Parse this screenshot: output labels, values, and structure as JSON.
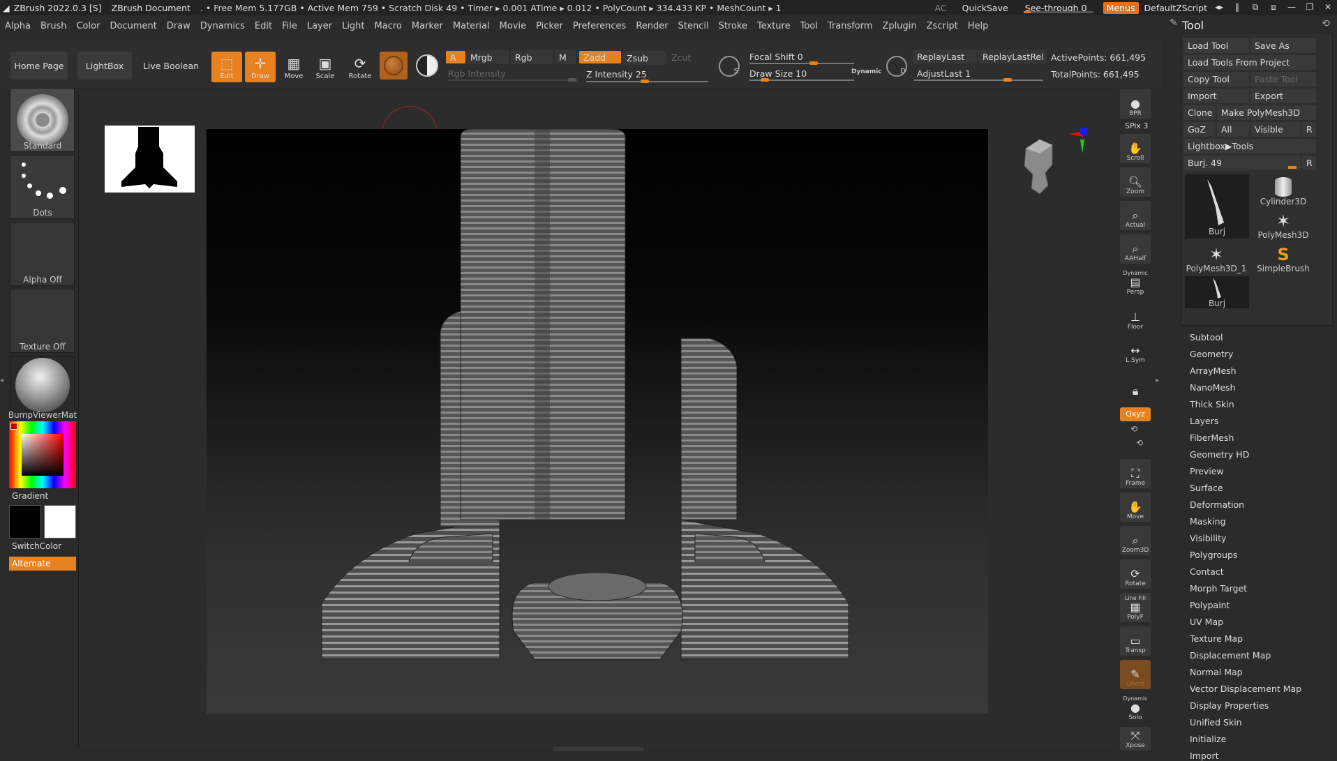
{
  "titlebar": {
    "app": "ZBrush 2022.0.3 [S]",
    "document": "ZBrush Document",
    "stats": ". • Free Mem 5.177GB • Active Mem 759 • Scratch Disk 49 •  Timer ▸ 0.001 ATime ▸ 0.012 • PolyCount ▸ 334.433 KP  • MeshCount ▸ 1",
    "ac": "AC",
    "quicksave": "QuickSave",
    "see_through_label": "See-through  0",
    "menus": "Menus",
    "default_zscript": "DefaultZScript"
  },
  "menubar": [
    "Alpha",
    "Brush",
    "Color",
    "Document",
    "Draw",
    "Dynamics",
    "Edit",
    "File",
    "Layer",
    "Light",
    "Macro",
    "Marker",
    "Material",
    "Movie",
    "Picker",
    "Preferences",
    "Render",
    "Stencil",
    "Stroke",
    "Texture",
    "Tool",
    "Transform",
    "Zplugin",
    "Zscript",
    "Help"
  ],
  "controls": {
    "home_page": "Home Page",
    "lightbox": "LightBox",
    "live_boolean": "Live Boolean",
    "edit": "Edit",
    "draw": "Draw",
    "move": "Move",
    "scale": "Scale",
    "rotate": "Rotate",
    "a": "A",
    "mrgb": "Mrgb",
    "rgb": "Rgb",
    "m": "M",
    "zadd": "Zadd",
    "zsub": "Zsub",
    "zcut": "Zcut",
    "rgb_intensity": "Rgb Intensity",
    "z_intensity": "Z Intensity 25",
    "focal_shift": "Focal Shift 0",
    "draw_size": "Draw Size 10",
    "dynamic": "Dynamic",
    "replay_last": "ReplayLast",
    "replay_last_rel": "ReplayLastRel",
    "adjust_last": "AdjustLast 1",
    "active_points": "ActivePoints: 661,495",
    "total_points": "TotalPoints: 661,495",
    "s_label": "S",
    "d_label": "D"
  },
  "left": {
    "brush": "Standard",
    "stroke": "Dots",
    "alpha": "Alpha Off",
    "texture": "Texture Off",
    "material": "BumpViewerMat",
    "gradient": "Gradient",
    "switch_color": "SwitchColor",
    "alternate": "Alternate"
  },
  "rightbar": {
    "bpr": "BPR",
    "spix": "SPix 3",
    "scroll": "Scroll",
    "zoom": "Zoom",
    "actual": "Actual",
    "aahalf": "AAHalf",
    "dynamic": "Dynamic",
    "persp": "Persp",
    "floor": "Floor",
    "lsym": "L.Sym",
    "xyz": "Qxyz",
    "frame": "Frame",
    "move": "Move",
    "zoom3d": "Zoom3D",
    "rotate": "Rotate",
    "line_fill": "Line Fill",
    "polyf": "PolyF",
    "transp": "Transp",
    "ghost": "Ghost",
    "dynamic2": "Dynamic",
    "solo": "Solo",
    "xpose": "Xpose"
  },
  "tool": {
    "title": "Tool",
    "load_tool": "Load Tool",
    "save_as": "Save As",
    "load_from_project": "Load Tools From Project",
    "copy_tool": "Copy Tool",
    "paste_tool": "Paste Tool",
    "import": "Import",
    "export": "Export",
    "clone": "Clone",
    "make_polymesh": "Make PolyMesh3D",
    "goz": "GoZ",
    "all": "All",
    "visible": "Visible",
    "r": "R",
    "lightbox_tools": "Lightbox▶Tools",
    "burj_slider": "Burj. 49",
    "thumbs": [
      "Burj",
      "Cylinder3D",
      "PolyMesh3D",
      "PolyMesh3D_1",
      "SimpleBrush",
      "Burj"
    ],
    "sections": [
      "Subtool",
      "Geometry",
      "ArrayMesh",
      "NanoMesh",
      "Thick Skin",
      "Layers",
      "FiberMesh",
      "Geometry HD",
      "Preview",
      "Surface",
      "Deformation",
      "Masking",
      "Visibility",
      "Polygroups",
      "Contact",
      "Morph Target",
      "Polypaint",
      "UV Map",
      "Texture Map",
      "Displacement Map",
      "Normal Map",
      "Vector Displacement Map",
      "Display Properties",
      "Unified Skin",
      "Initialize",
      "Import"
    ]
  },
  "colors": {
    "accent": "#e8821f",
    "panel": "#2b2b2b"
  }
}
